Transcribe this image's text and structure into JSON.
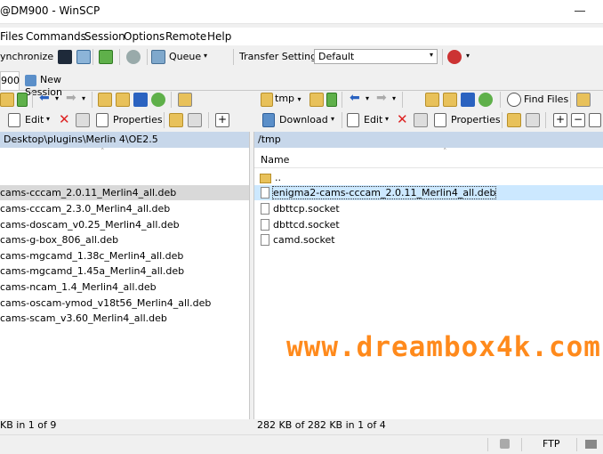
{
  "window": {
    "title": "@DM900 - WinSCP"
  },
  "menu": [
    "Files",
    "Commands",
    "Session",
    "Options",
    "Remote",
    "Help"
  ],
  "toolbar": {
    "synchronize_label": "ynchronize",
    "queue_label": "Queue",
    "transfer_settings_label": "Transfer Settings",
    "transfer_settings_value": "Default"
  },
  "tabs": {
    "current": "900",
    "new_session": "New Session"
  },
  "left": {
    "path": "Desktop\\plugins\\Merlin 4\\OE2.5",
    "edit_label": "Edit",
    "properties_label": "Properties",
    "files": [
      "cams-cccam_2.0.11_Merlin4_all.deb",
      "cams-cccam_2.3.0_Merlin4_all.deb",
      "cams-doscam_v0.25_Merlin4_all.deb",
      "cams-g-box_806_all.deb",
      "cams-mgcamd_1.38c_Merlin4_all.deb",
      "cams-mgcamd_1.45a_Merlin4_all.deb",
      "cams-ncam_1.4_Merlin4_all.deb",
      "cams-oscam-ymod_v18t56_Merlin4_all.deb",
      "cams-scam_v3.60_Merlin4_all.deb"
    ],
    "status": "KB in 1 of 9"
  },
  "right": {
    "dir_combo": "tmp",
    "find_files_label": "Find Files",
    "download_label": "Download",
    "edit_label": "Edit",
    "properties_label": "Properties",
    "path": "/tmp",
    "column_name": "Name",
    "parent": "..",
    "files": [
      "enigma2-cams-cccam_2.0.11_Merlin4_all.deb",
      "dbttcp.socket",
      "dbttcd.socket",
      "camd.socket"
    ],
    "status": "282 KB of 282 KB in 1 of 4"
  },
  "statusbar": {
    "protocol": "FTP"
  },
  "watermark": "www.dreambox4k.com",
  "colors": {
    "path_bar": "#c7d7ea",
    "selection": "#cce8ff",
    "watermark": "#ff8a1c"
  }
}
